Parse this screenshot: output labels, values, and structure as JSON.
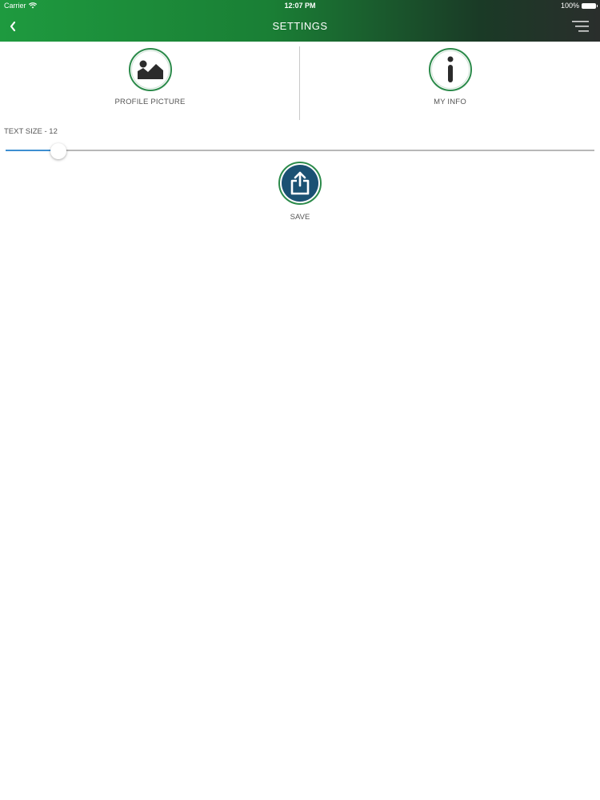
{
  "status_bar": {
    "carrier": "Carrier",
    "time": "12:07 PM",
    "battery": "100%",
    "icons": [
      "wifi-icon",
      "battery-icon"
    ]
  },
  "nav": {
    "title": "SETTINGS",
    "back_icon": "chevron-left-icon",
    "menu_icon": "menu-lines-icon"
  },
  "actions": {
    "profile_picture": {
      "label": "PROFILE PICTURE",
      "icon": "image-icon"
    },
    "my_info": {
      "label": "MY INFO",
      "icon": "info-icon"
    }
  },
  "text_size": {
    "label": "TEXT SIZE - 12",
    "value": 12,
    "slider_fraction": 0.09
  },
  "save": {
    "label": "SAVE",
    "icon": "share-upload-icon"
  },
  "colors": {
    "header_green": "#1e9a3f",
    "icon_ring": "#2b8a4a",
    "save_fill": "#1b5173",
    "slider_fill": "#3d8fd1"
  }
}
